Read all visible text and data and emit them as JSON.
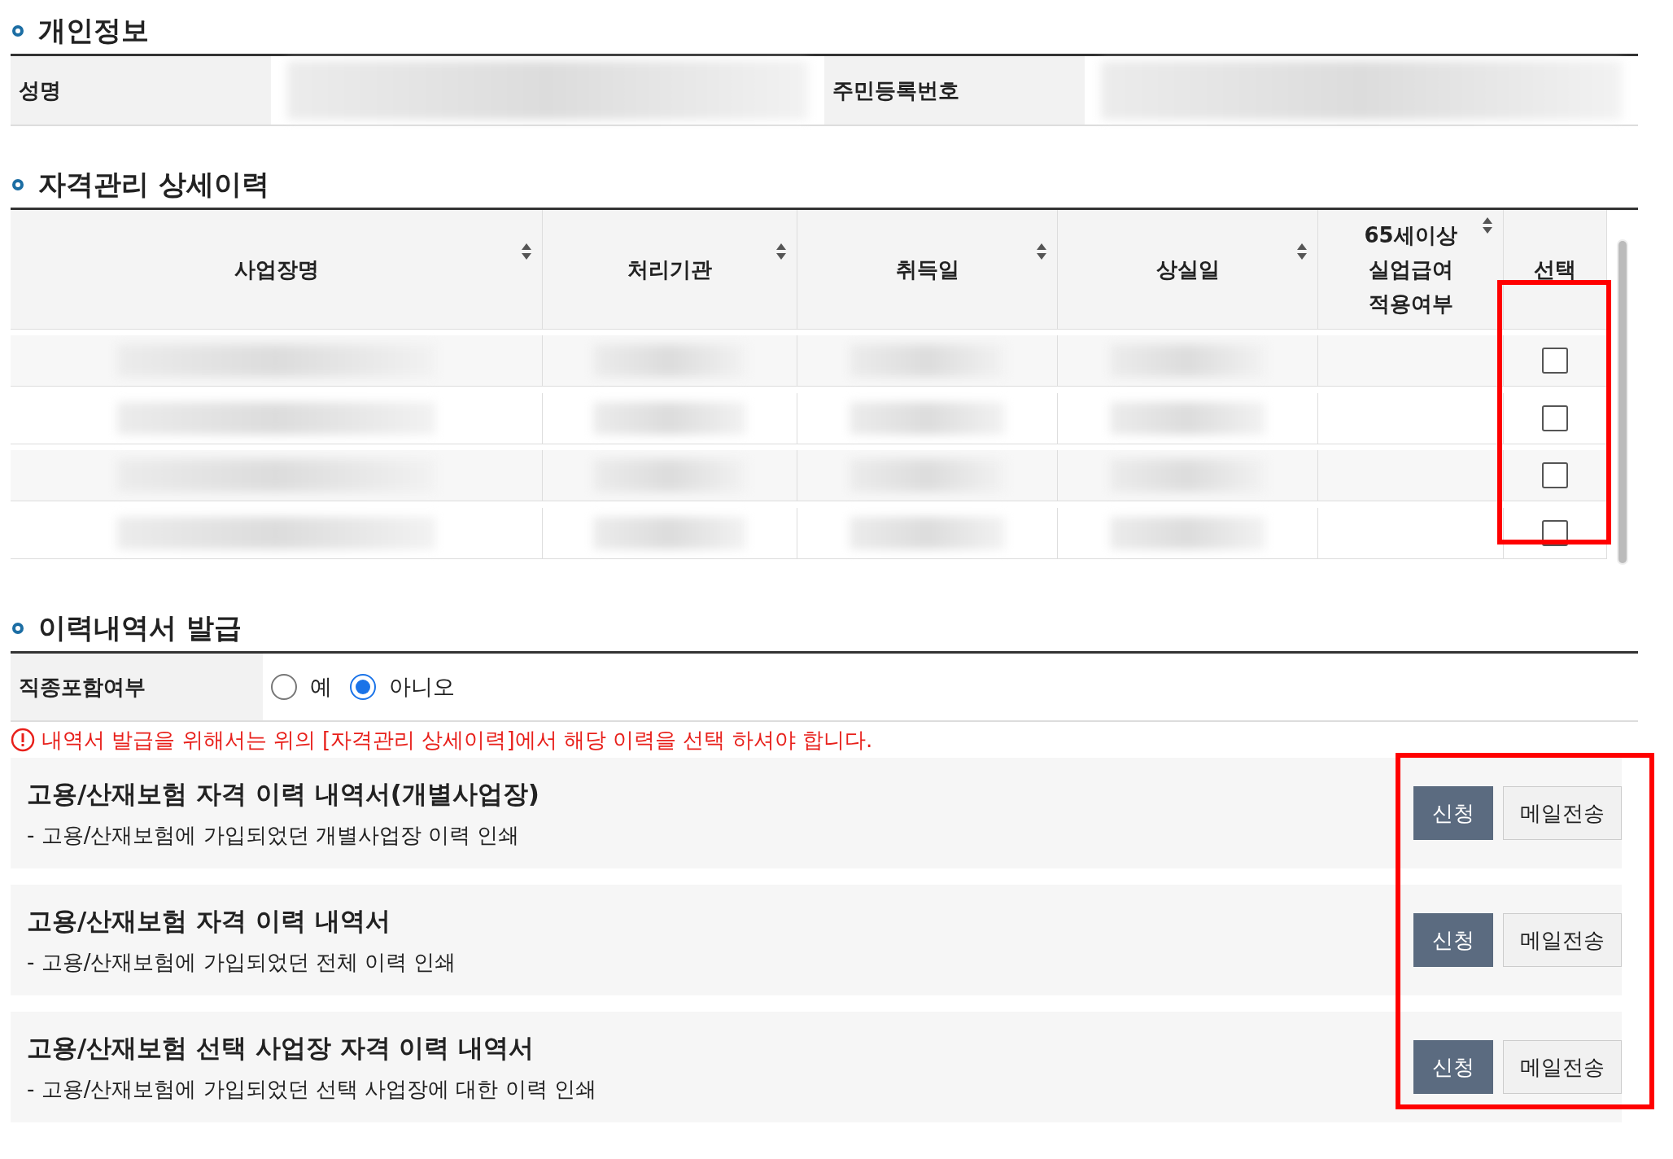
{
  "personal_info": {
    "title": "개인정보",
    "fields": [
      {
        "label": "성명"
      },
      {
        "label": "주민등록번호"
      }
    ]
  },
  "history": {
    "title": "자격관리 상세이력",
    "columns": [
      {
        "lines": [
          "사업장명"
        ],
        "sortable": true
      },
      {
        "lines": [
          "처리기관"
        ],
        "sortable": true
      },
      {
        "lines": [
          "취득일"
        ],
        "sortable": true
      },
      {
        "lines": [
          "상실일"
        ],
        "sortable": true
      },
      {
        "lines": [
          "65세이상",
          "실업급여",
          "적용여부"
        ],
        "sortable": true
      },
      {
        "lines": [
          "선택"
        ],
        "sortable": false
      }
    ],
    "rows": [
      {
        "checked": false
      },
      {
        "checked": false
      },
      {
        "checked": false
      },
      {
        "checked": false
      }
    ]
  },
  "issue": {
    "title": "이력내역서 발급",
    "option": {
      "label": "직종포함여부",
      "choices": [
        {
          "label": "예",
          "selected": false
        },
        {
          "label": "아니오",
          "selected": true
        }
      ]
    },
    "warning": "내역서 발급을 위해서는 위의 [자격관리 상세이력]에서 해당 이력을 선택 하셔야 합니다.",
    "documents": [
      {
        "title": "고용/산재보험 자격 이력 내역서(개별사업장)",
        "description": "- 고용/산재보험에 가입되었던 개별사업장 이력 인쇄",
        "buttons": [
          "신청",
          "메일전송"
        ]
      },
      {
        "title": "고용/산재보험 자격 이력 내역서",
        "description": "- 고용/산재보험에 가입되었던 전체 이력 인쇄",
        "buttons": [
          "신청",
          "메일전송"
        ]
      },
      {
        "title": "고용/산재보험 선택 사업장 자격 이력 내역서",
        "description": "- 고용/산재보험에 가입되었던 선택 사업장에 대한 이력 인쇄",
        "buttons": [
          "신청",
          "메일전송"
        ]
      }
    ]
  }
}
